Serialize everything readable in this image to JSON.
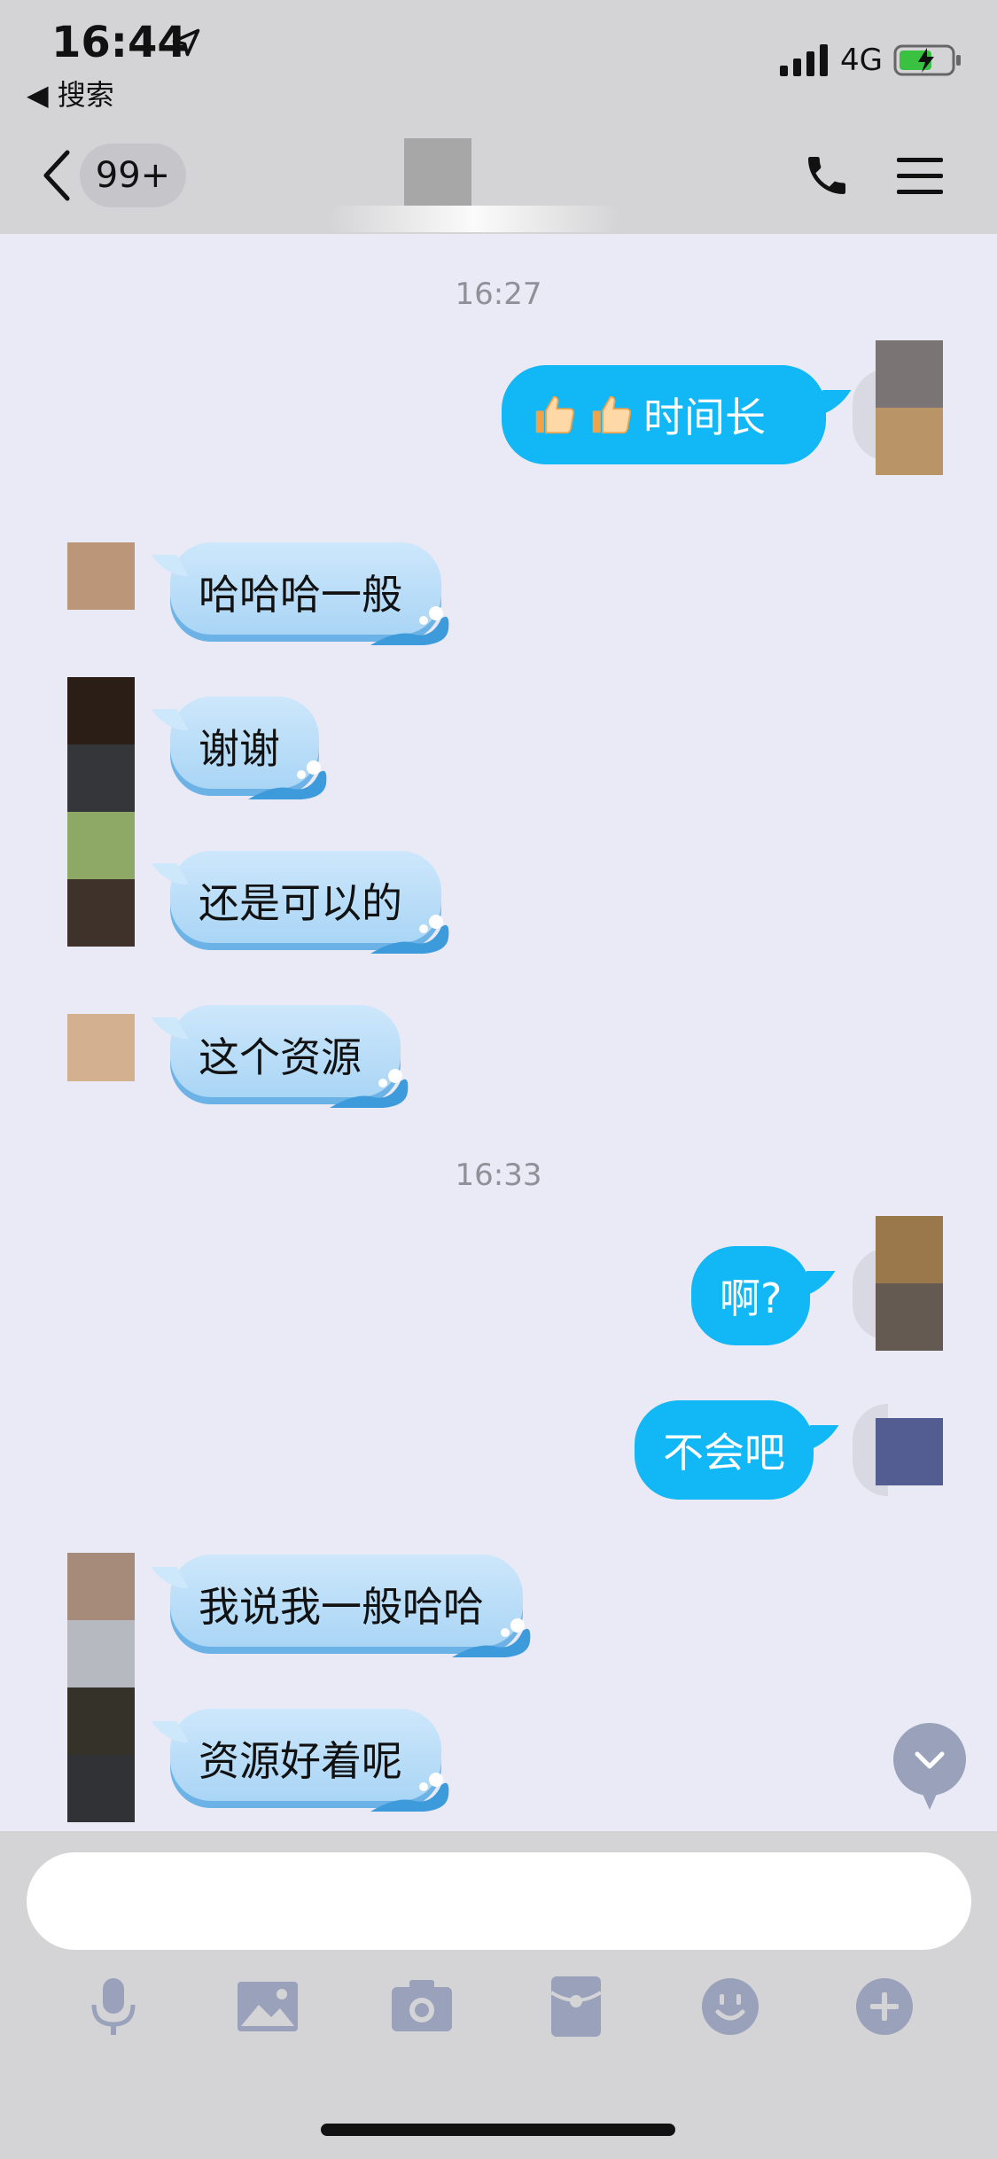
{
  "status_bar": {
    "time": "16:44",
    "back_app": "◀ 搜索",
    "network": "4G"
  },
  "header": {
    "unread_count": "99+"
  },
  "messages": {
    "ts1": "16:27",
    "m1": "时间长",
    "m2": "哈哈哈一般",
    "m3": "谢谢",
    "m4": "还是可以的",
    "m5": "这个资源",
    "ts2": "16:33",
    "m6": "啊?",
    "m7": "不会吧",
    "m8": "我说我一般哈哈",
    "m9": "资源好着呢"
  },
  "input": {
    "placeholder": ""
  },
  "toolbar": [
    "microphone-icon",
    "image-icon",
    "camera-icon",
    "red-packet-icon",
    "emoji-icon",
    "plus-icon"
  ],
  "colors": {
    "outgoing_bubble": "#12b7f5",
    "incoming_bubble": "#bcdff8",
    "chat_bg": "#e9eaf5",
    "bar_bg": "#d4d4d6"
  }
}
